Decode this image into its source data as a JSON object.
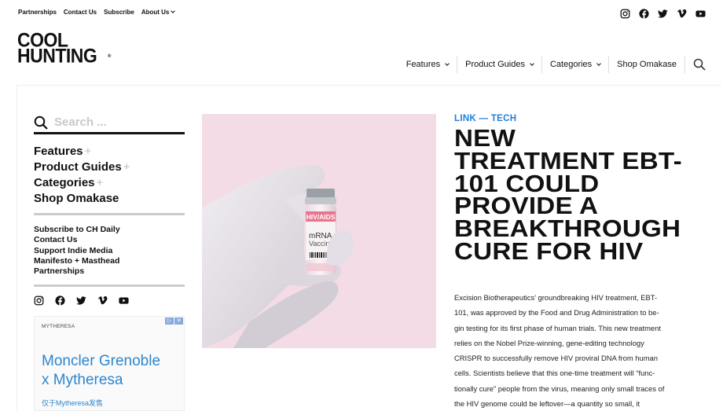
{
  "topbar": {
    "links": [
      "Partnerships",
      "Contact Us",
      "Subscribe",
      "About Us"
    ]
  },
  "logo": {
    "line1": "COOL",
    "line2": "HUNTING",
    "mark": "®"
  },
  "mainnav": {
    "items": [
      "Features",
      "Product Guides",
      "Categories",
      "Shop Omakase"
    ]
  },
  "sidebar": {
    "search_placeholder": "Search ...",
    "nav": [
      "Features",
      "Product Guides",
      "Categories",
      "Shop Omakase"
    ],
    "plus": "+",
    "links": [
      "Subscribe to CH Daily",
      "Contact Us",
      "Support Indie Media",
      "Manifesto + Masthead",
      "Partnerships"
    ]
  },
  "ad": {
    "brand": "MYTHERESA",
    "headline_line1": "Moncler Grenoble",
    "headline_line2": "x Mytheresa",
    "sub": "仅于Mytheresa发售"
  },
  "hero": {
    "vial_label_top": "HIV/AIDS",
    "vial_label_main1": "mRNA",
    "vial_label_main2": "Vaccine"
  },
  "article": {
    "kicker_a": "LINK",
    "kicker_sep": "—",
    "kicker_b": "TECH",
    "title_lines": [
      "NEW",
      "TREATMENT EBT-",
      "101 COULD",
      "PROVIDE A",
      "BREAKTHROUGH",
      "CURE FOR HIV"
    ],
    "body_lines": [
      "Excision Biotherapeutics’ groundbreaking HIV treatment, EBT-",
      "101, was approved by the Food and Drug Administration to be-",
      "gin testing for its first phase of human trials. This new treatment",
      "relies on the Nobel Prize-winning, gene-editing technology",
      "CRISPR to successfully remove HIV proviral DNA from human",
      "cells. Scientists believe that this one-time treatment will “func-",
      "tionally cure” people from the virus, meaning only small traces of",
      "the HIV genome could be leftover—a quantity so small, it"
    ]
  },
  "colors": {
    "accent": "#1f7fd6",
    "hero_bg": "#f4dce6",
    "ad_blue": "#2d86cf"
  },
  "icons": [
    "instagram-icon",
    "facebook-icon",
    "twitter-icon",
    "vimeo-icon",
    "youtube-icon",
    "search-icon"
  ]
}
